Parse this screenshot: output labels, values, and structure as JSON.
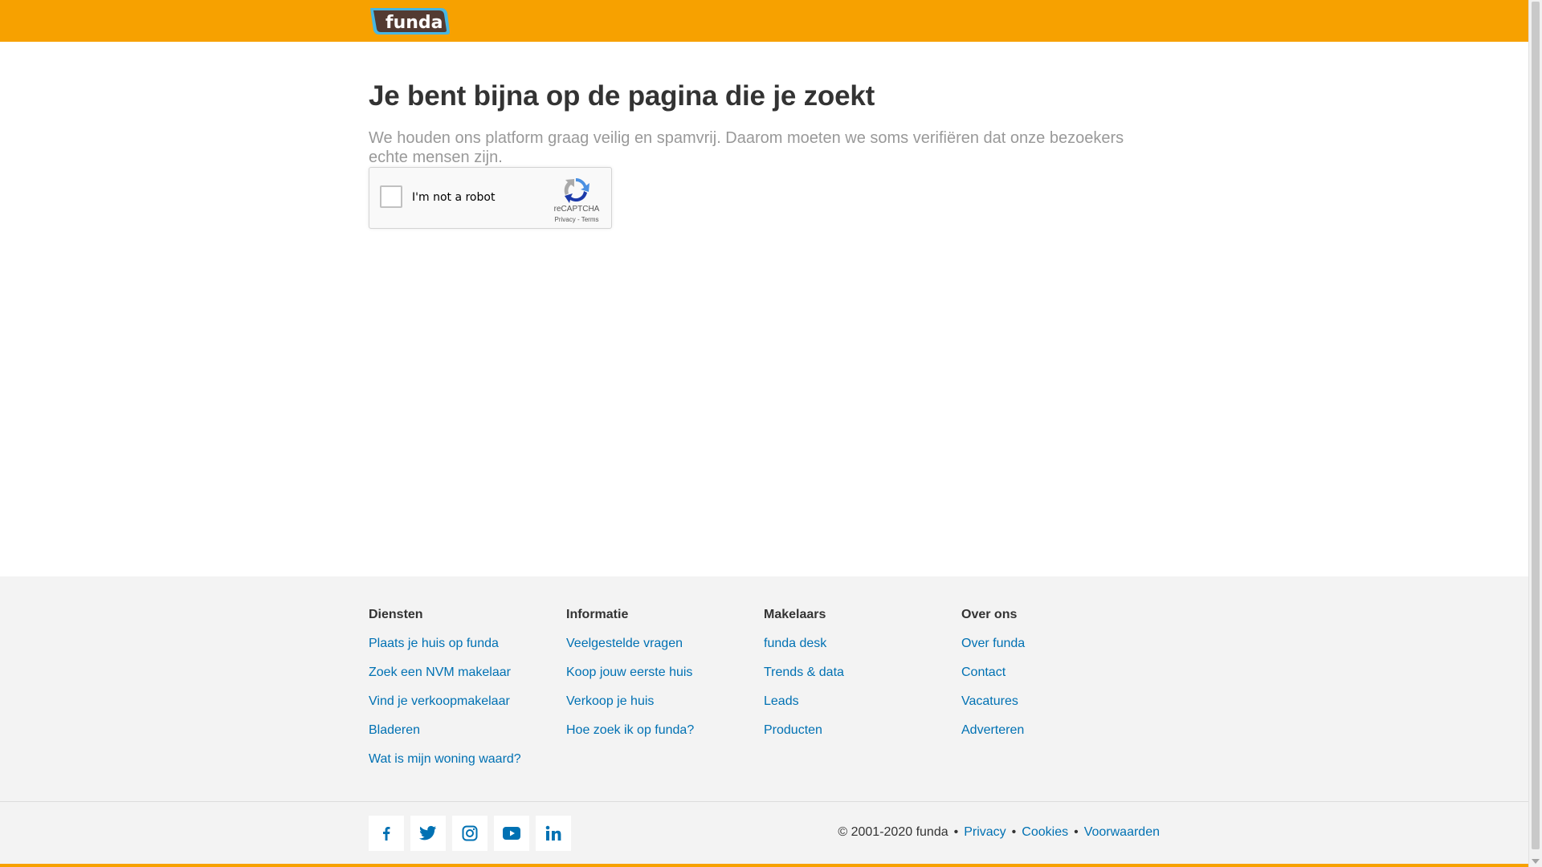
{
  "brand": {
    "logo_text": "funda",
    "colors": {
      "accent": "#f7a100",
      "link": "#0071b3",
      "logo_fill": "#533b32",
      "logo_outline": "#47b7e3"
    }
  },
  "main": {
    "title": "Je bent bijna op de pagina die je zoekt",
    "intro": "We houden ons platform graag veilig en spamvrij. Daarom moeten we soms verifiëren dat onze bezoekers echte mensen zijn."
  },
  "captcha": {
    "label": "I'm not a robot",
    "brand": "reCAPTCHA",
    "links": "Privacy - Terms",
    "checked": false
  },
  "footer": {
    "columns": [
      {
        "heading": "Diensten",
        "links": [
          "Plaats je huis op funda",
          "Zoek een NVM makelaar",
          "Vind je verkoopmakelaar",
          "Bladeren",
          "Wat is mijn woning waard?"
        ]
      },
      {
        "heading": "Informatie",
        "links": [
          "Veelgestelde vragen",
          "Koop jouw eerste huis",
          "Verkoop je huis",
          "Hoe zoek ik op funda?"
        ]
      },
      {
        "heading": "Makelaars",
        "links": [
          "funda desk",
          "Trends & data",
          "Leads",
          "Producten"
        ]
      },
      {
        "heading": "Over ons",
        "links": [
          "Over funda",
          "Contact",
          "Vacatures",
          "Adverteren"
        ]
      }
    ],
    "socials": [
      "facebook-icon",
      "twitter-icon",
      "instagram-icon",
      "youtube-icon",
      "linkedin-icon"
    ],
    "copyright": "© 2001-2020 funda",
    "legal_links": [
      "Privacy",
      "Cookies",
      "Voorwaarden"
    ]
  }
}
